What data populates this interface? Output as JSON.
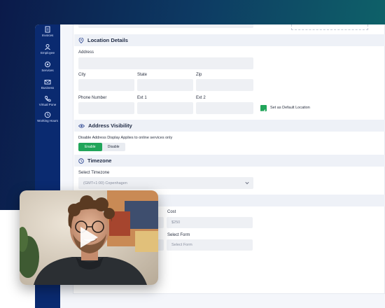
{
  "sidebar": {
    "items": [
      {
        "label": "Invoices",
        "icon": "document-icon"
      },
      {
        "label": "Employee",
        "icon": "user-icon"
      },
      {
        "label": "Services",
        "icon": "services-icon"
      },
      {
        "label": "Business",
        "icon": "mail-icon"
      },
      {
        "label": "Virtual Pone",
        "icon": "phone-icon"
      },
      {
        "label": "Working Hours",
        "icon": "clock-icon"
      }
    ]
  },
  "location": {
    "title": "Location Details",
    "address_label": "Address",
    "city_label": "City",
    "state_label": "State",
    "zip_label": "Zip",
    "phone_label": "Phone Number",
    "ext1_label": "Ext 1",
    "ext2_label": "Ext 2",
    "default_label": "Set as Default Location"
  },
  "visibility": {
    "title": "Address Visibility",
    "description": "Disable Address Display Applies to online services only",
    "enable_label": "Enable",
    "disable_label": "Disable"
  },
  "timezone": {
    "title": "Timezone",
    "select_label": "Select Timezone",
    "selected_value": "(GMT+1:00) Copenhagen"
  },
  "pricing": {
    "cost_label": "Cost",
    "cost_value": "$250",
    "form_label": "Select Form",
    "form_placeholder": "Select Form"
  },
  "colors": {
    "sidebar": "#0a2a70",
    "accent": "#21a55a",
    "section_bg": "#eef1f7"
  }
}
